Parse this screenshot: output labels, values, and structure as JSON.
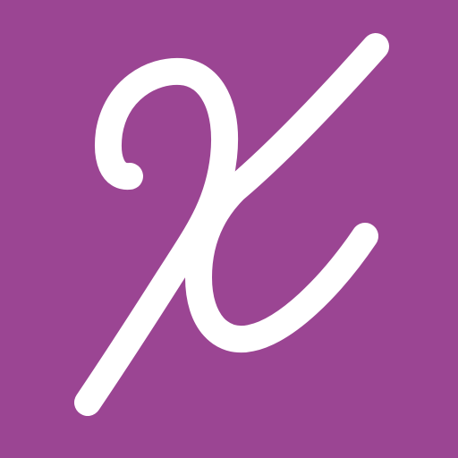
{
  "icon": {
    "name": "cursive-x-logo-icon",
    "background_color": "#9b4593",
    "glyph_color": "#ffffff"
  }
}
